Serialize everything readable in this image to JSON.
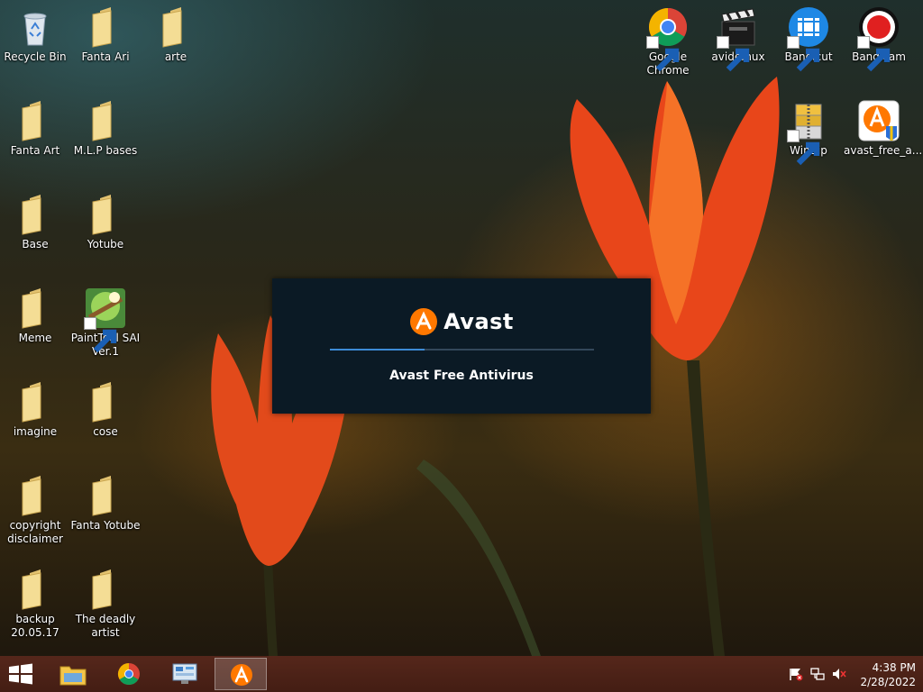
{
  "desktop": {
    "icons": [
      {
        "label": "Recycle Bin",
        "icon": "recycle-bin-icon"
      },
      {
        "label": "Fanta Ari",
        "icon": "folder-icon"
      },
      {
        "label": "arte",
        "icon": "folder-icon"
      },
      {
        "label": "Fanta Art",
        "icon": "folder-icon"
      },
      {
        "label": "M.L.P bases",
        "icon": "folder-icon"
      },
      {
        "label": "Base",
        "icon": "folder-icon"
      },
      {
        "label": "Yotube",
        "icon": "folder-icon"
      },
      {
        "label": "Meme",
        "icon": "folder-icon"
      },
      {
        "label": "PaintTool SAI Ver.1",
        "icon": "painttool-sai-icon"
      },
      {
        "label": "imagine",
        "icon": "folder-icon"
      },
      {
        "label": "cose",
        "icon": "folder-icon"
      },
      {
        "label": "copyright disclaimer",
        "icon": "folder-icon"
      },
      {
        "label": "Fanta Yotube",
        "icon": "folder-icon"
      },
      {
        "label": "backup 20.05.17",
        "icon": "folder-icon"
      },
      {
        "label": "The deadly artist",
        "icon": "folder-icon"
      },
      {
        "label": "Google Chrome",
        "icon": "chrome-icon"
      },
      {
        "label": "avidemux",
        "icon": "avidemux-icon"
      },
      {
        "label": "Bandicut",
        "icon": "bandicut-icon"
      },
      {
        "label": "Bandicam",
        "icon": "bandicam-icon"
      },
      {
        "label": "WinZip",
        "icon": "winzip-icon"
      },
      {
        "label": "avast_free_a...",
        "icon": "avast-installer-icon"
      }
    ]
  },
  "splash": {
    "brand": "Avast",
    "product": "Avast Free Antivirus",
    "progress": 0.36,
    "colors": {
      "background": "#0b1a25",
      "accent": "#ff7800",
      "progress": "#3d8bd6"
    }
  },
  "taskbar": {
    "pinned": [
      {
        "icon": "file-explorer-icon"
      },
      {
        "icon": "chrome-icon"
      },
      {
        "icon": "control-panel-icon"
      },
      {
        "icon": "avast-icon",
        "active": true
      }
    ],
    "tray": [
      {
        "icon": "action-center-flag-icon"
      },
      {
        "icon": "network-icon"
      },
      {
        "icon": "volume-muted-icon"
      }
    ],
    "time": "4:38 PM",
    "date": "2/28/2022"
  }
}
